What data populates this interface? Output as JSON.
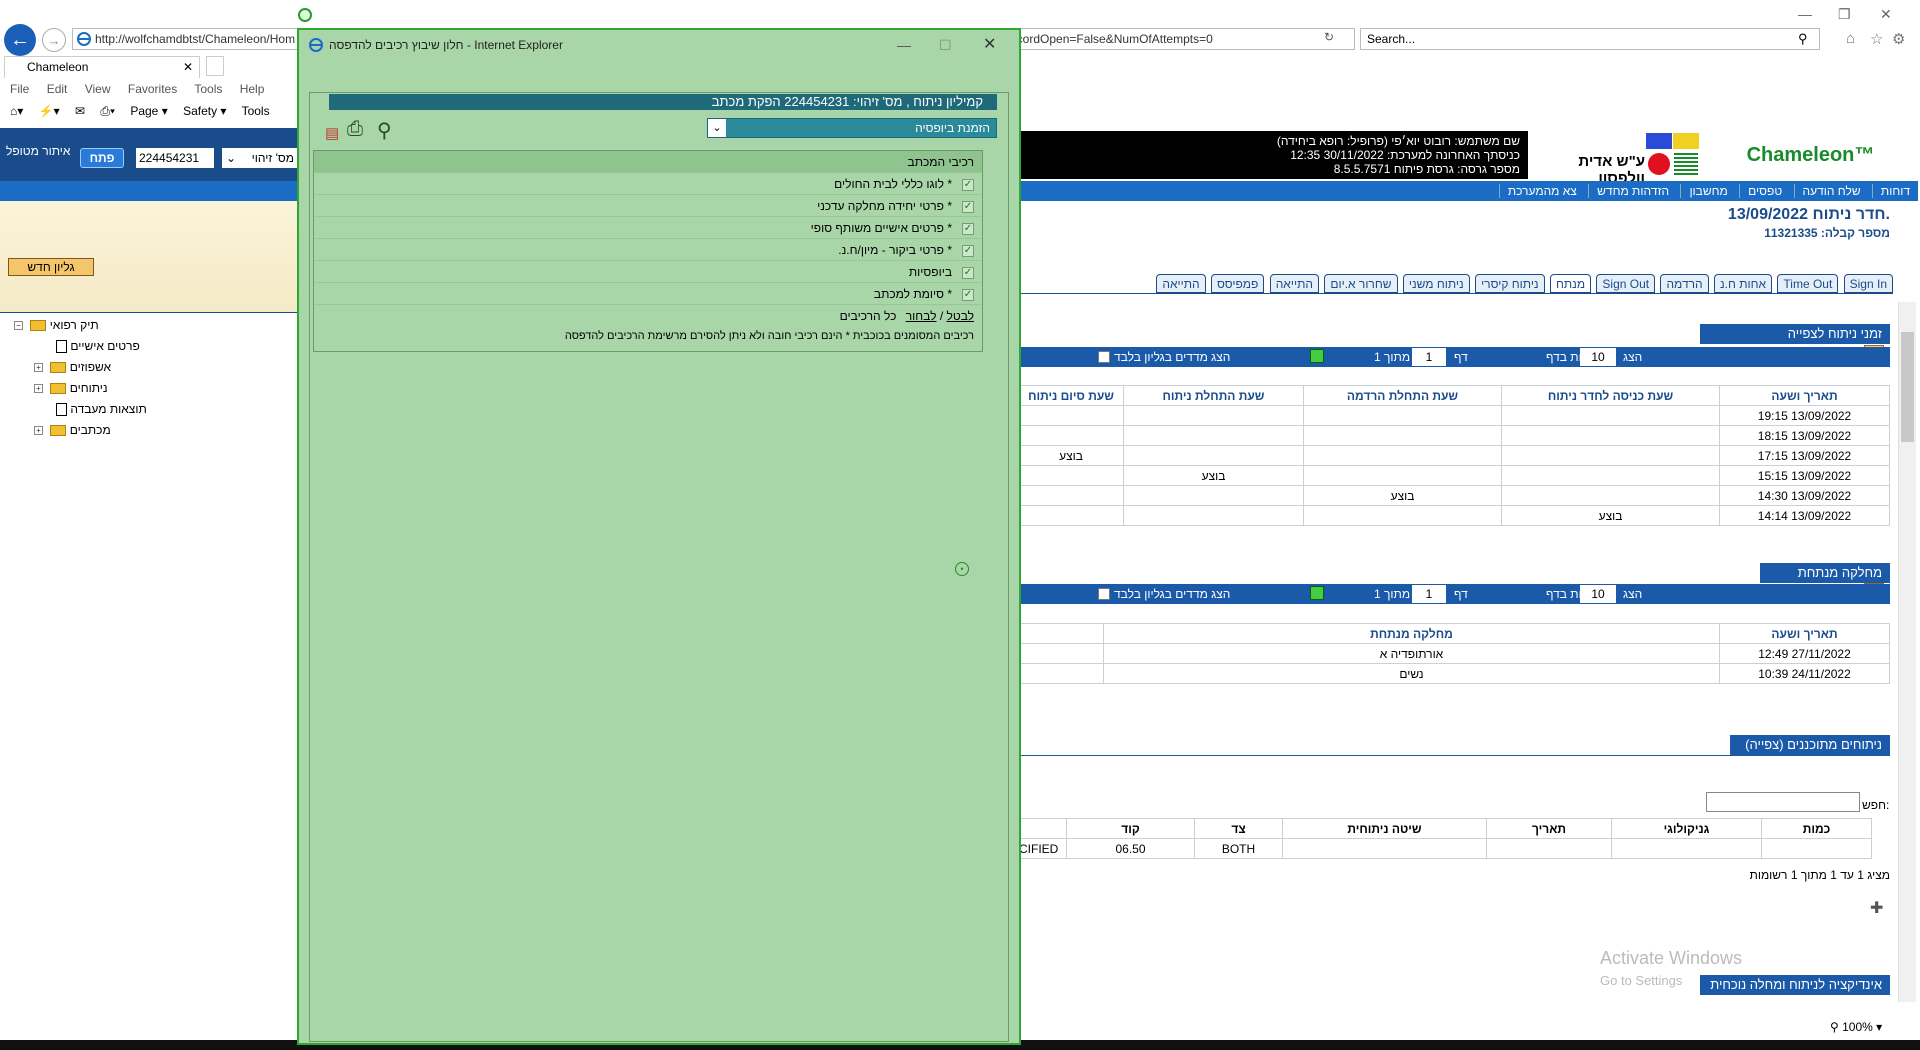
{
  "browser": {
    "url": "http://wolfchamdbtst/Chameleon/Hom",
    "url_tail": "ecordOpen=False&NumOfAttempts=0",
    "search_placeholder": "Search...",
    "tab_title": "Chameleon",
    "menu": [
      "File",
      "Edit",
      "View",
      "Favorites",
      "Tools",
      "Help"
    ],
    "commands": [
      "Page ▾",
      "Safety ▾",
      "Tools"
    ],
    "zoom": "100%"
  },
  "left": {
    "locate_label": "איתור מטופל",
    "open_button": "פתח",
    "id_value": "224454231",
    "id_type": "מס' זיהוי",
    "new_page_button": "גליון חדש",
    "tree": [
      {
        "label": "תיק רפואי",
        "kind": "folder"
      },
      {
        "label": "פרטים אישיים",
        "kind": "doc"
      },
      {
        "label": "אשפוזים",
        "kind": "folder"
      },
      {
        "label": "ניתוחים",
        "kind": "folder"
      },
      {
        "label": "תוצאות מעבדה",
        "kind": "doc"
      },
      {
        "label": "מכתבים",
        "kind": "folder"
      }
    ]
  },
  "header": {
    "user_line": "שם משתמש: רובוט יוא׳פי (פרופיל: רופא ביחידה)",
    "last_login": "כניסתך האחרונה למערכת: 30/11/2022 12:35",
    "version": "מספר גרסה: גרסת פיתוח 8.5.5.7571",
    "hospital": "ע\"ש אדית וולפסון",
    "app_name": "Chameleon™",
    "nav": [
      "דוחות",
      "שלח הודעה",
      "טפסים",
      "מחשבון",
      "הזדהות מחדש",
      "צא מהמערכת"
    ]
  },
  "page": {
    "title": "חדר ניתוח 13/09/2022.",
    "subtitle": "מספר קבלה: 11321335",
    "tabs": [
      "Sign In",
      "Time Out",
      "אחות ח.נ",
      "הרדמה",
      "Sign Out",
      "מנתח",
      "ניתוח קיסרי",
      "ניתוח משני",
      "שחרור א.יום",
      "התייאה",
      "פמפיסס",
      "התייאה"
    ]
  },
  "section1": {
    "title": "זמני ניתוח לצפייה",
    "show": "הצג",
    "rows_value": "10",
    "rows_label": "שורות בדף",
    "page_label": "דף",
    "page_value": "1",
    "of_label": "מתוך 1",
    "filter_label": "הצג מדדים בגליון בלבד",
    "columns": [
      "תאריך ושעה",
      "שעת כניסה לחדר ניתוח",
      "שעת התחלת הרדמה",
      "שעת התחלת ניתוח",
      "שעת סיום ניתוח"
    ],
    "rows": [
      [
        "13/09/2022 19:15",
        "",
        "",
        "",
        ""
      ],
      [
        "13/09/2022 18:15",
        "",
        "",
        "",
        ""
      ],
      [
        "13/09/2022 17:15",
        "",
        "",
        "",
        "בוצע"
      ],
      [
        "13/09/2022 15:15",
        "",
        "",
        "בוצע",
        ""
      ],
      [
        "13/09/2022 14:30",
        "",
        "בוצע",
        "",
        ""
      ],
      [
        "13/09/2022 14:14",
        "בוצע",
        "",
        "",
        ""
      ]
    ]
  },
  "section2": {
    "title": "מחלקה מנתחת",
    "show": "הצג",
    "rows_value": "10",
    "rows_label": "שורות בדף",
    "page_label": "דף",
    "page_value": "1",
    "of_label": "מתוך 1",
    "filter_label": "הצג מדדים בגליון בלבד",
    "columns": [
      "תאריך ושעה",
      "מחלקה מנתחת"
    ],
    "rows": [
      [
        "27/11/2022 12:49",
        "אורתופדיה א"
      ],
      [
        "24/11/2022 10:39",
        "נשים"
      ]
    ]
  },
  "section3": {
    "title": "ניתוחים מתוכננים (צפייה)",
    "search_label": "חפש:",
    "columns": [
      "כמות",
      "גניקולוגי",
      "תאריך",
      "שיטה ניתוחית",
      "צד",
      "קוד"
    ],
    "row": [
      "",
      "",
      "",
      "",
      "BOTH",
      "06.50"
    ],
    "row_cut": "CIFIED",
    "footer": "מציג 1 עד 1 מתוך 1 רשומות"
  },
  "section4": {
    "title": "אינדיקציה לניתוח ומחלה נוכחית"
  },
  "watermark": {
    "line1": "Activate Windows",
    "line2": "Go to Settings"
  },
  "modal": {
    "title": "חלון שיבוץ רכיבים להדפסה - Internet Explorer",
    "band": "קמיליון ניתוח , מס' זיהוי: 224454231 הפקת מכתב",
    "selected": "הזמנת ביופסיה",
    "list_header": "רכיבי המכתב",
    "items": [
      {
        "label": "* לוגו כללי לבית החולים",
        "checked": true
      },
      {
        "label": "* פרטי יחידה מחלקה עדכני",
        "checked": true
      },
      {
        "label": "* פרטים אישיים משותף סופי",
        "checked": true
      },
      {
        "label": "* פרטי ביקור - מיון/ח.נ.",
        "checked": true
      },
      {
        "label": "ביופסיות",
        "checked": true
      },
      {
        "label": "* סיומת למכתב",
        "checked": true
      }
    ],
    "cancel_link": "לבטל",
    "choose_link": "לבחור",
    "all_label": "כל הרכיבים",
    "note": "רכיבים המסומנים בכוכבית * הינם רכיבי חובה ולא ניתן להסירם מרשימת הרכיבים להדפסה"
  }
}
